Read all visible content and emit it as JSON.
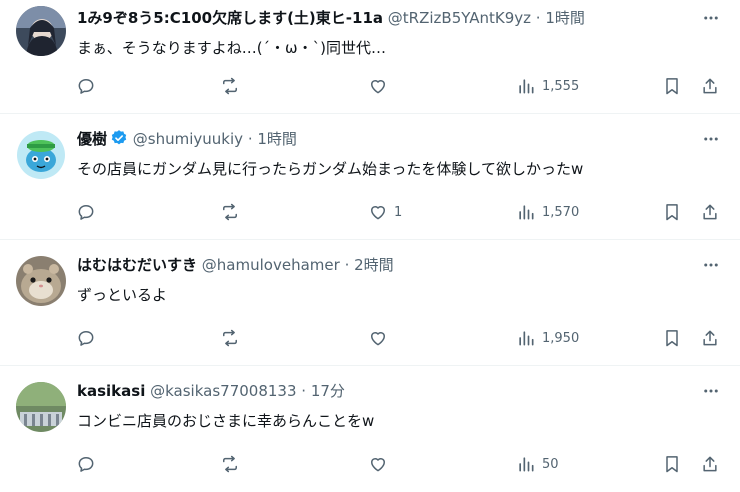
{
  "tweets": [
    {
      "name": "1み9ぞ8う5:C100欠席します(土)東ヒ-11a",
      "handle": "@tRZizB5YAntK9yz",
      "dot": "·",
      "time": "1時間",
      "verified": false,
      "text": "まぁ、そうなりますよね…(´・ω・`)同世代…",
      "replies": "",
      "retweets": "",
      "likes": "",
      "views": "1,555"
    },
    {
      "name": "優樹",
      "handle": "@shumiyuukiy",
      "dot": "·",
      "time": "1時間",
      "verified": true,
      "text": "その店員にガンダム見に行ったらガンダム始まったを体験して欲しかったw",
      "replies": "",
      "retweets": "",
      "likes": "1",
      "views": "1,570"
    },
    {
      "name": "はむはむだいすき",
      "handle": "@hamulovehamer",
      "dot": "·",
      "time": "2時間",
      "verified": false,
      "text": "ずっといるよ",
      "replies": "",
      "retweets": "",
      "likes": "",
      "views": "1,950"
    },
    {
      "name": "kasikasi",
      "handle": "@kasikas77008133",
      "dot": "·",
      "time": "17分",
      "verified": false,
      "text": "コンビニ店員のおじさまに幸あらんことをw",
      "replies": "",
      "retweets": "",
      "likes": "",
      "views": "50"
    }
  ],
  "icons": {
    "more": "more-icon",
    "reply": "reply-icon",
    "retweet": "retweet-icon",
    "like": "heart-icon",
    "views": "analytics-icon",
    "bookmark": "bookmark-icon",
    "share": "share-icon",
    "verified": "verified-badge-icon"
  },
  "colors": {
    "text": "#0f1419",
    "secondary": "#536471",
    "verified": "#1d9bf0",
    "divider": "#eff3f4"
  }
}
